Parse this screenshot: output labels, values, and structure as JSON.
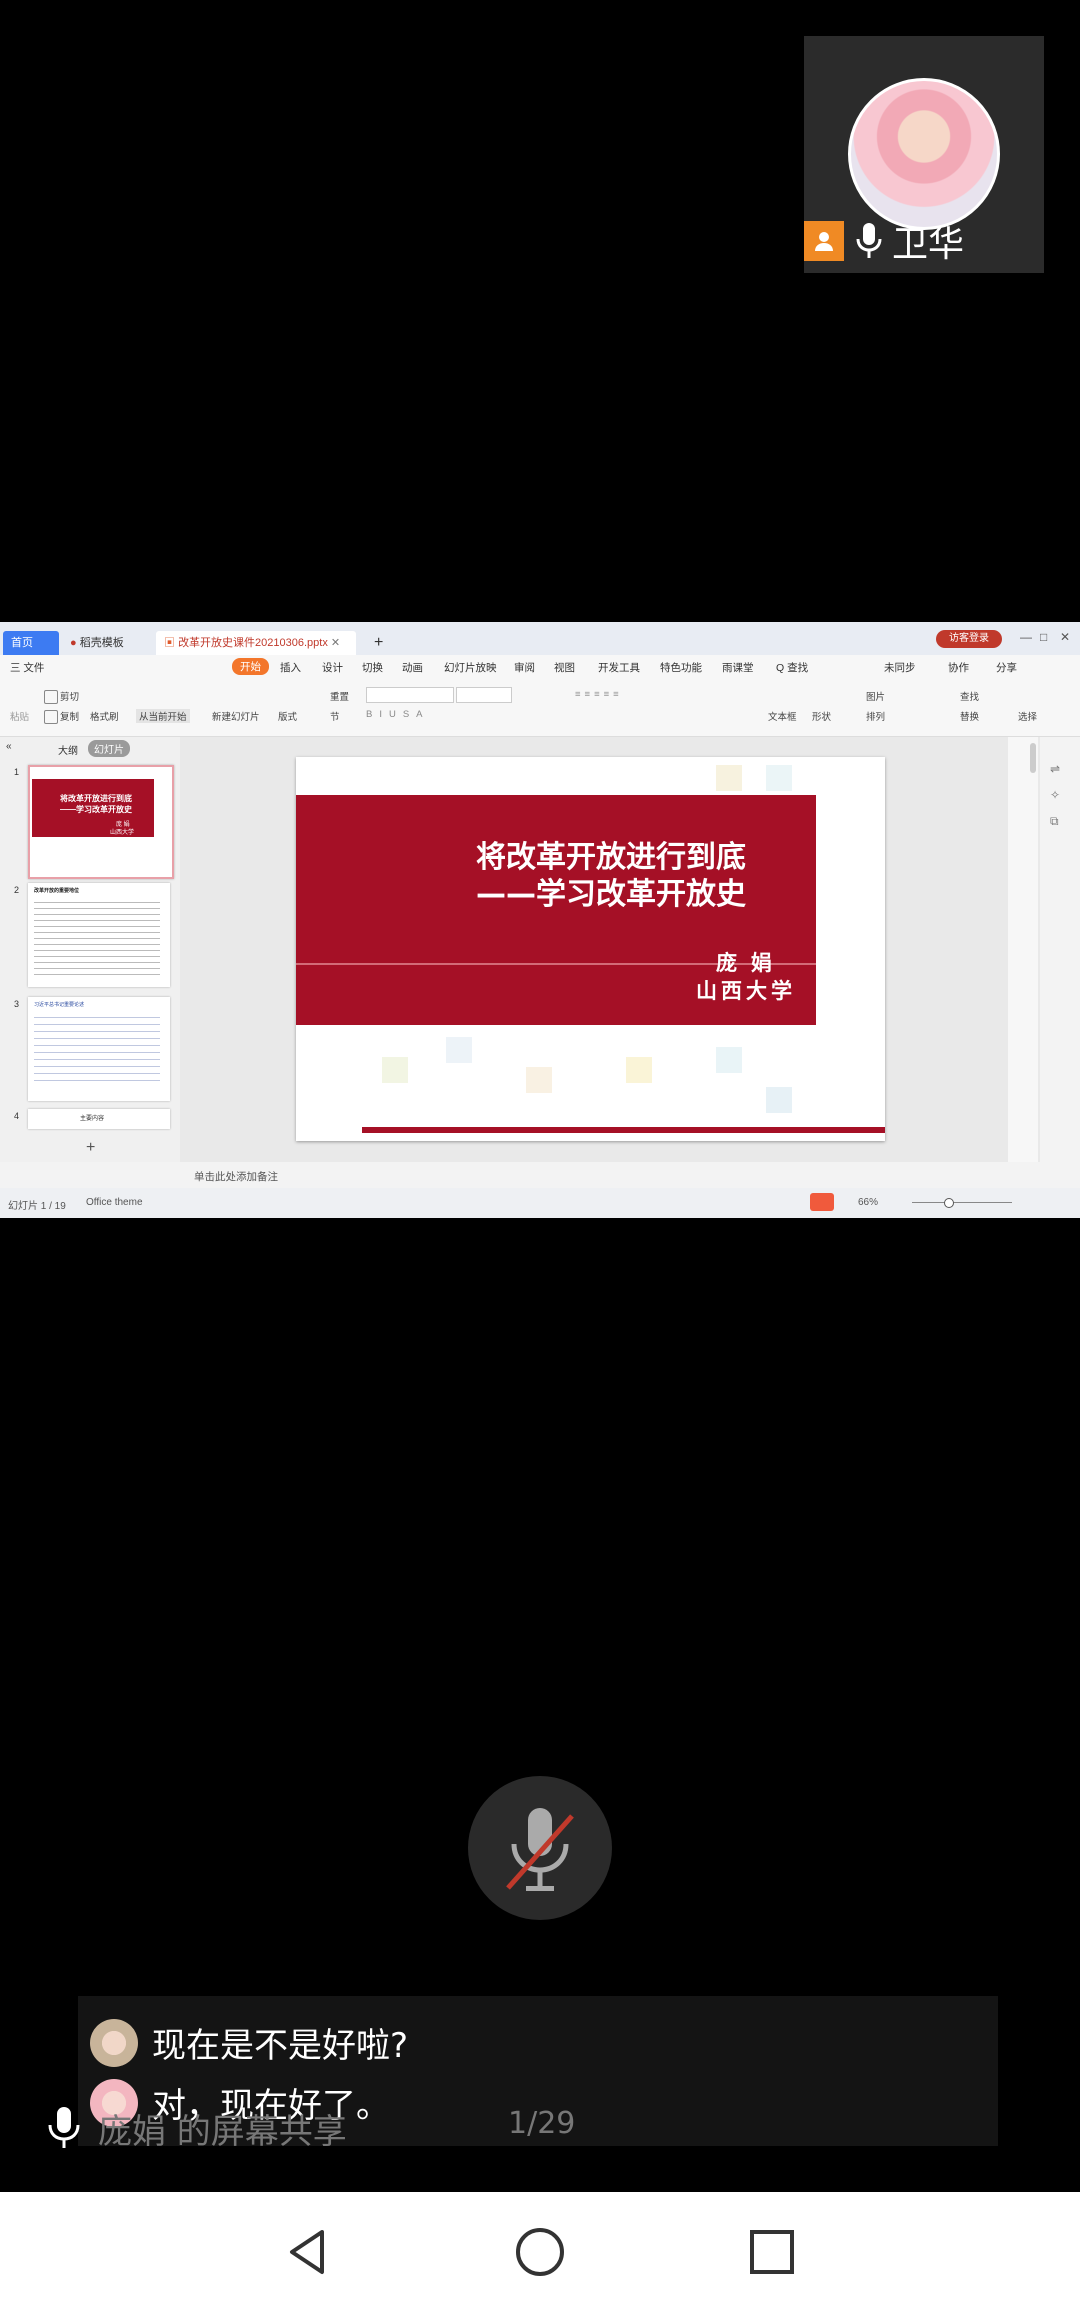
{
  "participant": {
    "name": "卫华"
  },
  "wps": {
    "tabs": {
      "home": "首页",
      "template": "稻壳模板",
      "document": "改革开放史课件20210306.pptx"
    },
    "login": "访客登录",
    "menu": [
      "三 文件",
      "开始",
      "插入",
      "设计",
      "切换",
      "动画",
      "幻灯片放映",
      "审阅",
      "视图",
      "开发工具",
      "特色功能",
      "雨课堂",
      "Q 查找"
    ],
    "menu_right": [
      "未同步",
      "协作",
      "分享"
    ],
    "ribbon": {
      "cut": "剪切",
      "copy": "复制",
      "format_painter": "格式刷",
      "paste": "粘贴",
      "from_current": "从当前开始",
      "new_slide": "新建幻灯片",
      "layout": "版式",
      "section": "节",
      "reset": "重置",
      "textbox": "文本框",
      "shape": "形状",
      "arrange": "排列",
      "picture": "图片",
      "find": "查找",
      "replace": "替换",
      "select": "选择"
    },
    "panel_tabs": [
      "大纲",
      "幻灯片"
    ],
    "thumbnails": [
      {
        "num": "1",
        "title": "将改革开放进行到底",
        "subtitle": "——学习改革开放史",
        "author": "庞 娟",
        "org": "山西大学"
      },
      {
        "num": "2",
        "title": "改革开放的重要地位"
      },
      {
        "num": "3",
        "title": "习近平总书记重要论述"
      },
      {
        "num": "4",
        "title": "主要内容"
      }
    ],
    "slide": {
      "title_line1": "将改革开放进行到底",
      "title_line2": "——学习改革开放史",
      "author": "庞 娟",
      "org": "山西大学"
    },
    "notes_placeholder": "单击此处添加备注",
    "status": {
      "slide_count": "幻灯片 1 / 19",
      "theme": "Office theme",
      "zoom": "66%"
    }
  },
  "captions": [
    {
      "text": "现在是不是好啦?"
    },
    {
      "text": "对，现在好了。"
    }
  ],
  "share": {
    "label": "庞娟 的屏幕共享",
    "page": "1/29"
  },
  "colors": {
    "slide_red": "#a51026",
    "host_badge": "#f08a24",
    "wps_accent": "#f3762b"
  }
}
